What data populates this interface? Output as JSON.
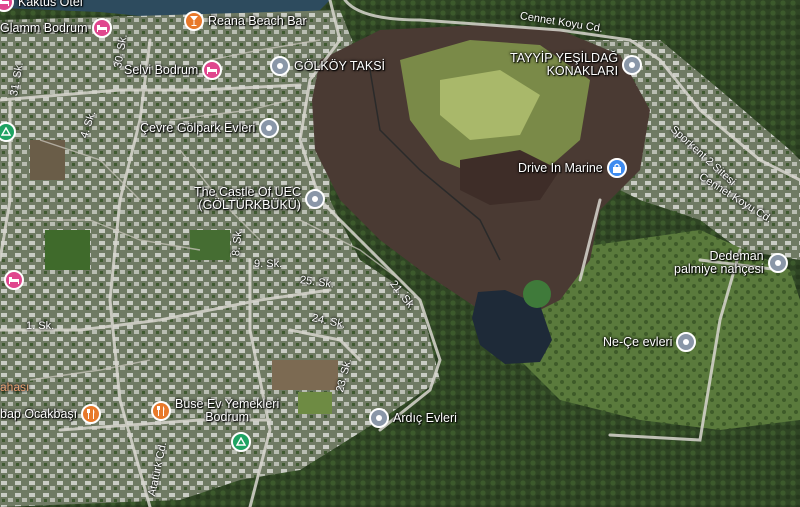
{
  "colors": {
    "gray_pin": "#8a97a8",
    "pink_pin": "#e0468e",
    "orange_pin": "#e8792b",
    "green_pin": "#1ea362",
    "blue_pin": "#3d8bf0",
    "street_label": "#ffffff"
  },
  "pois": {
    "kaktus_otel": {
      "label": "Kaktüs Otel",
      "icon": "hotel-bed-icon"
    },
    "glamm_bodrum": {
      "label": "Glamm Bodrum",
      "icon": "hotel-bed-icon"
    },
    "reana_beach_bar": {
      "label": "Reana Beach Bar",
      "icon": "cocktail-glass-icon"
    },
    "selvi_bodrum": {
      "label": "Selvi Bodrum",
      "icon": "hotel-bed-icon"
    },
    "golkoy_taksi": {
      "label": "GÖLKÖY TAKSİ",
      "icon": "map-pin-icon"
    },
    "tayyip_yesildag": {
      "line1": "TAYYİP YEŞİLDAĞ",
      "line2": "KONAKLARI",
      "icon": "map-pin-icon"
    },
    "cevre_golpark": {
      "label": "Çevre Gölpark Evleri",
      "icon": "map-pin-icon"
    },
    "drive_in_marine": {
      "label": "Drive In Marine",
      "icon": "shopping-bag-icon"
    },
    "castle_of_uec": {
      "line1": "The Castle Of UEC",
      "line2": "(GÖLTÜRKBÜKÜ)",
      "icon": "map-pin-icon"
    },
    "dedeman": {
      "line1": "Dedeman",
      "line2": "palmiye nahçesi",
      "icon": "map-pin-icon"
    },
    "ne_ce_evleri": {
      "label": "Ne-Çe evleri",
      "icon": "map-pin-icon"
    },
    "buse_ev": {
      "line1": "Buse Ev Yemekleri",
      "line2": "Bodrum",
      "icon": "fork-knife-icon"
    },
    "ardic_evleri": {
      "label": "Ardıç Evleri",
      "icon": "map-pin-icon"
    },
    "kebap_ocakbasi": {
      "label": "bap Ocakbaşı",
      "icon": "fork-knife-icon"
    },
    "partial_left": {
      "label": "ahası"
    },
    "park_left": {
      "icon": "park-tree-icon"
    },
    "park_bottom": {
      "icon": "park-tree-icon"
    },
    "hotel_left": {
      "icon": "hotel-bed-icon"
    }
  },
  "streets": {
    "cennet_koyu_top": "Cennet Koyu Cd.",
    "cennet_koyu_right": "Cennet Koyu Cd.",
    "sporkent": "Sporkent 2 Sitesi",
    "sk_31": "31. Sk.",
    "sk_30": "30. Sk.",
    "sk_4": "4. Sk.",
    "sk_8": "8. Sk.",
    "sk_9": "9. Sk.",
    "sk_25": "25. Sk.",
    "sk_21": "21. Sk.",
    "sk_24": "24. Sk.",
    "sk_1": "1. Sk.",
    "sk_23": "23. Sk.",
    "ataturk": "Atatürk Cd."
  }
}
